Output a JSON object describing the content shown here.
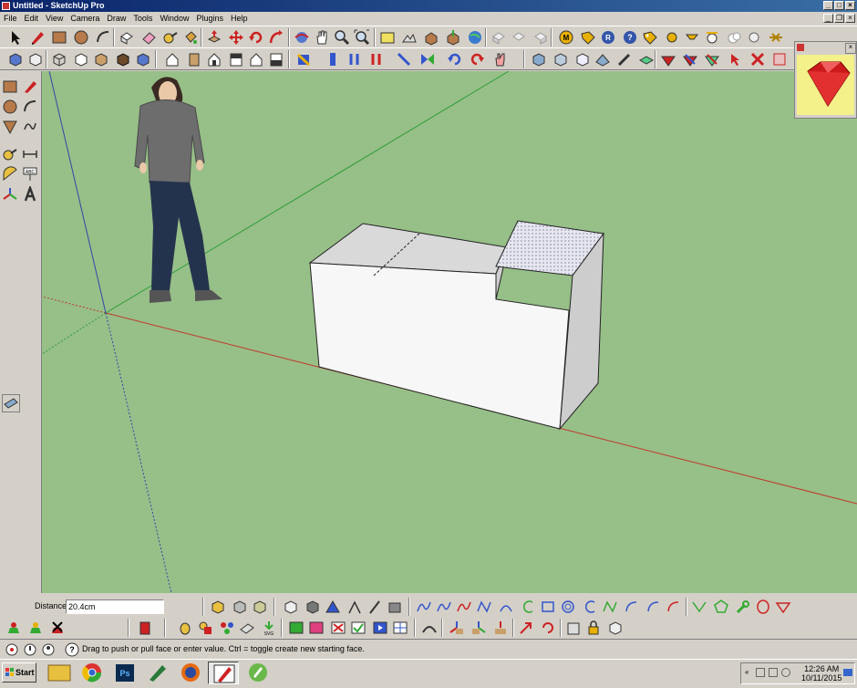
{
  "window": {
    "title": "Untitled - SketchUp Pro"
  },
  "menu": [
    "File",
    "Edit",
    "View",
    "Camera",
    "Draw",
    "Tools",
    "Window",
    "Plugins",
    "Help"
  ],
  "measurements": {
    "label": "Distance",
    "value": "20.4cm"
  },
  "status": {
    "hint": "Drag to push or pull face or enter value.  Ctrl = toggle create new starting face."
  },
  "taskbar": {
    "start_label": "Start",
    "time": "12:26 AM",
    "date": "10/11/2015"
  },
  "colors": {
    "ground": "#97bf88",
    "red_axis": "#c0392b",
    "green_axis": "#2f9e3a",
    "blue_axis": "#3344aa",
    "ruby": "#f4f08a"
  }
}
